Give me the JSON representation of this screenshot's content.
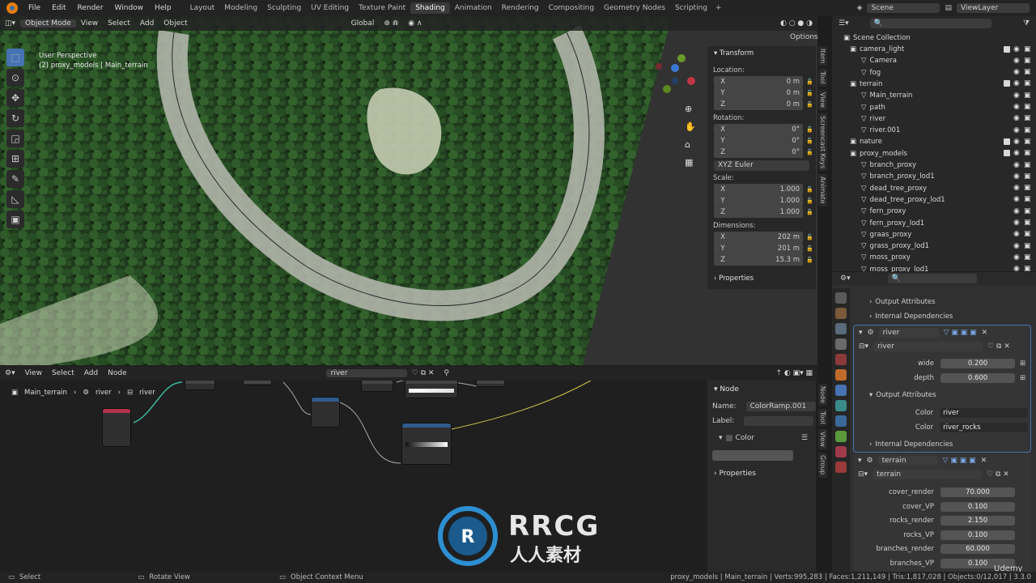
{
  "menu": [
    "File",
    "Edit",
    "Render",
    "Window",
    "Help"
  ],
  "workspaces": [
    "Layout",
    "Modeling",
    "Sculpting",
    "UV Editing",
    "Texture Paint",
    "Shading",
    "Animation",
    "Rendering",
    "Compositing",
    "Geometry Nodes",
    "Scripting"
  ],
  "active_workspace": "Shading",
  "scene": "Scene",
  "view_layer": "ViewLayer",
  "viewport": {
    "mode": "Object Mode",
    "menus": [
      "View",
      "Select",
      "Add",
      "Object"
    ],
    "transform_orientation": "Global",
    "options": "Options",
    "overlay_title": "User Perspective",
    "overlay_subtitle": "(2) proxy_models | Main_terrain"
  },
  "npanel": {
    "tabs": [
      "Item",
      "Tool",
      "View",
      "Screencast Keys",
      "Animate"
    ],
    "transform": "Transform",
    "location": "Location:",
    "loc": [
      {
        "k": "X",
        "v": "0 m"
      },
      {
        "k": "Y",
        "v": "0 m"
      },
      {
        "k": "Z",
        "v": "0 m"
      }
    ],
    "rotation": "Rotation:",
    "rot": [
      {
        "k": "X",
        "v": "0°"
      },
      {
        "k": "Y",
        "v": "0°"
      },
      {
        "k": "Z",
        "v": "0°"
      }
    ],
    "euler": "XYZ Euler",
    "scale": "Scale:",
    "scl": [
      {
        "k": "X",
        "v": "1.000"
      },
      {
        "k": "Y",
        "v": "1.000"
      },
      {
        "k": "Z",
        "v": "1.000"
      }
    ],
    "dimensions": "Dimensions:",
    "dim": [
      {
        "k": "X",
        "v": "202 m"
      },
      {
        "k": "Y",
        "v": "201 m"
      },
      {
        "k": "Z",
        "v": "15.3 m"
      }
    ],
    "properties": "Properties"
  },
  "outliner": {
    "root": "Scene Collection",
    "items": [
      {
        "name": "camera_light",
        "level": 1
      },
      {
        "name": "Camera",
        "level": 2
      },
      {
        "name": "fog",
        "level": 2
      },
      {
        "name": "terrain",
        "level": 1
      },
      {
        "name": "Main_terrain",
        "level": 2
      },
      {
        "name": "path",
        "level": 2
      },
      {
        "name": "river",
        "level": 2
      },
      {
        "name": "river.001",
        "level": 2
      },
      {
        "name": "nature",
        "level": 1
      },
      {
        "name": "proxy_models",
        "level": 1
      },
      {
        "name": "branch_proxy",
        "level": 2
      },
      {
        "name": "branch_proxy_lod1",
        "level": 2
      },
      {
        "name": "dead_tree_proxy",
        "level": 2
      },
      {
        "name": "dead_tree_proxy_lod1",
        "level": 2
      },
      {
        "name": "fern_proxy",
        "level": 2
      },
      {
        "name": "fern_proxy_lod1",
        "level": 2
      },
      {
        "name": "graas_proxy",
        "level": 2
      },
      {
        "name": "grass_proxy_lod1",
        "level": 2
      },
      {
        "name": "moss_proxy",
        "level": 2
      },
      {
        "name": "moss_proxy_lod1",
        "level": 2
      }
    ]
  },
  "modifiers": {
    "output_attributes": "Output Attributes",
    "internal_dependencies": "Internal Dependencies",
    "river": {
      "name": "river",
      "group": "river",
      "inputs": [
        {
          "k": "wide",
          "v": "0.200"
        },
        {
          "k": "depth",
          "v": "0.600"
        }
      ],
      "outputs": [
        {
          "k": "Color",
          "v": "river"
        },
        {
          "k": "Color",
          "v": "river_rocks"
        }
      ]
    },
    "terrain": {
      "name": "terrain",
      "group": "terrain",
      "inputs": [
        {
          "k": "cover_render",
          "v": "70.000"
        },
        {
          "k": "cover_VP",
          "v": "0.100"
        },
        {
          "k": "rocks_render",
          "v": "2.150"
        },
        {
          "k": "rocks_VP",
          "v": "0.100"
        },
        {
          "k": "branches_render",
          "v": "60.000"
        },
        {
          "k": "branches_VP",
          "v": "0.100"
        }
      ]
    }
  },
  "node_editor": {
    "menus": [
      "View",
      "Select",
      "Add",
      "Node"
    ],
    "tree": "river",
    "breadcrumb": [
      "Main_terrain",
      "river",
      "river"
    ],
    "side_tabs": [
      "Node",
      "Tool",
      "View",
      "Group"
    ],
    "panel_title": "Node",
    "name_label": "Name:",
    "name_value": "ColorRamp.001",
    "label_label": "Label:",
    "color_label": "Color",
    "properties": "Properties"
  },
  "status": {
    "select": "Select",
    "rotate": "Rotate View",
    "context": "Object Context Menu",
    "stats": "proxy_models | Main_terrain | Verts:995,283 | Faces:1,211,149 | Tris:1,817,028 | Objects:0/12,017 | 3.3.0"
  },
  "watermark": {
    "brand": "RRCG",
    "cn": "人人素材",
    "udemy": "Udemy"
  }
}
